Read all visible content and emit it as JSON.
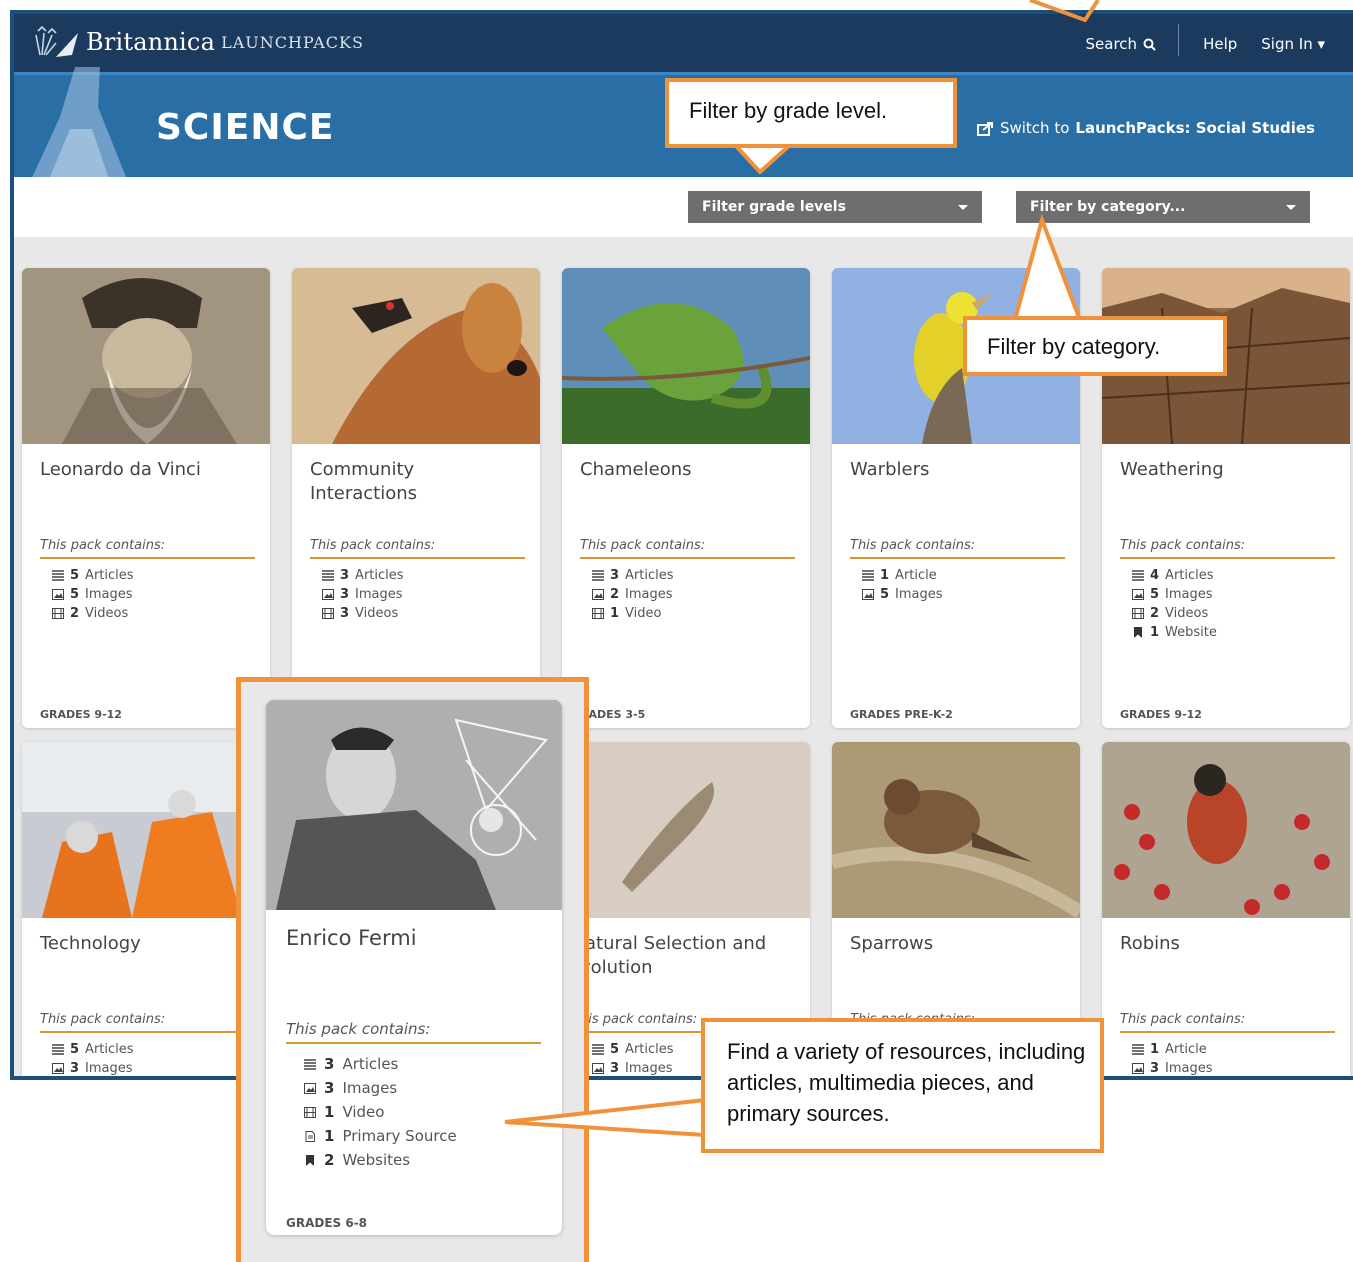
{
  "header": {
    "brand": "Britannica",
    "brand_sub": "LAUNCHPACKS",
    "search_label": "Search",
    "help_label": "Help",
    "signin_label": "Sign In ▾"
  },
  "banner": {
    "title": "SCIENCE",
    "switch_prefix": "Switch to ",
    "switch_target": "LaunchPacks: Social Studies"
  },
  "filters": {
    "grade_placeholder": "Filter grade levels",
    "category_placeholder": "Filter by category..."
  },
  "contains_label": "This pack contains:",
  "cards": [
    {
      "title": "Leonardo da Vinci",
      "resources": [
        {
          "icon": "list-icon",
          "count": "5",
          "label": "Articles"
        },
        {
          "icon": "image-icon",
          "count": "5",
          "label": "Images"
        },
        {
          "icon": "film-icon",
          "count": "2",
          "label": "Videos"
        }
      ],
      "grades": "GRADES 9-12"
    },
    {
      "title": "Community Interactions",
      "resources": [
        {
          "icon": "list-icon",
          "count": "3",
          "label": "Articles"
        },
        {
          "icon": "image-icon",
          "count": "3",
          "label": "Images"
        },
        {
          "icon": "film-icon",
          "count": "3",
          "label": "Videos"
        }
      ],
      "grades": ""
    },
    {
      "title": "Chameleons",
      "resources": [
        {
          "icon": "list-icon",
          "count": "3",
          "label": "Articles"
        },
        {
          "icon": "image-icon",
          "count": "2",
          "label": "Images"
        },
        {
          "icon": "film-icon",
          "count": "1",
          "label": "Video"
        }
      ],
      "grades": "RADES 3-5"
    },
    {
      "title": "Warblers",
      "resources": [
        {
          "icon": "list-icon",
          "count": "1",
          "label": "Article"
        },
        {
          "icon": "image-icon",
          "count": "5",
          "label": "Images"
        }
      ],
      "grades": "GRADES PRE-K-2"
    },
    {
      "title": "Weathering",
      "resources": [
        {
          "icon": "list-icon",
          "count": "4",
          "label": "Articles"
        },
        {
          "icon": "image-icon",
          "count": "5",
          "label": "Images"
        },
        {
          "icon": "film-icon",
          "count": "2",
          "label": "Videos"
        },
        {
          "icon": "bookmark-icon",
          "count": "1",
          "label": "Website"
        }
      ],
      "grades": "GRADES 9-12"
    },
    {
      "title": "Technology",
      "contains": "This pack contains:",
      "resources": [
        {
          "icon": "list-icon",
          "count": "5",
          "label": "Articles"
        },
        {
          "icon": "image-icon",
          "count": "3",
          "label": "Images"
        }
      ],
      "grades": ""
    },
    {
      "title": "",
      "resources": [],
      "grades": ""
    },
    {
      "title": "Natural Selection and Evolution",
      "title_display": "latural Selection and\nvolution",
      "contains": "his pack contains:",
      "resources": [
        {
          "icon": "list-icon",
          "count": "5",
          "label": "Articles"
        },
        {
          "icon": "image-icon",
          "count": "3",
          "label": "Images"
        }
      ],
      "grades": ""
    },
    {
      "title": "Sparrows",
      "contains": "This pack contains:",
      "resources": [],
      "grades": ""
    },
    {
      "title": "Robins",
      "contains": "This pack contains:",
      "resources": [
        {
          "icon": "list-icon",
          "count": "1",
          "label": "Article"
        },
        {
          "icon": "image-icon",
          "count": "3",
          "label": "Images"
        }
      ],
      "grades": ""
    }
  ],
  "featured": {
    "title": "Enrico Fermi",
    "resources": [
      {
        "icon": "list-icon",
        "count": "3",
        "label": "Articles"
      },
      {
        "icon": "image-icon",
        "count": "3",
        "label": "Images"
      },
      {
        "icon": "film-icon",
        "count": "1",
        "label": "Video"
      },
      {
        "icon": "document-icon",
        "count": "1",
        "label": "Primary Source"
      },
      {
        "icon": "bookmark-icon",
        "count": "2",
        "label": "Websites"
      }
    ],
    "grades": "GRADES 6-8"
  },
  "callouts": {
    "grade": "Filter by grade level.",
    "category": "Filter by category.",
    "resources": "Find a variety of resources, including articles, multimedia pieces, and primary sources."
  },
  "colors": {
    "accent": "#f0923a",
    "topbar": "#1b3a5e",
    "band": "#2a6ea6"
  }
}
